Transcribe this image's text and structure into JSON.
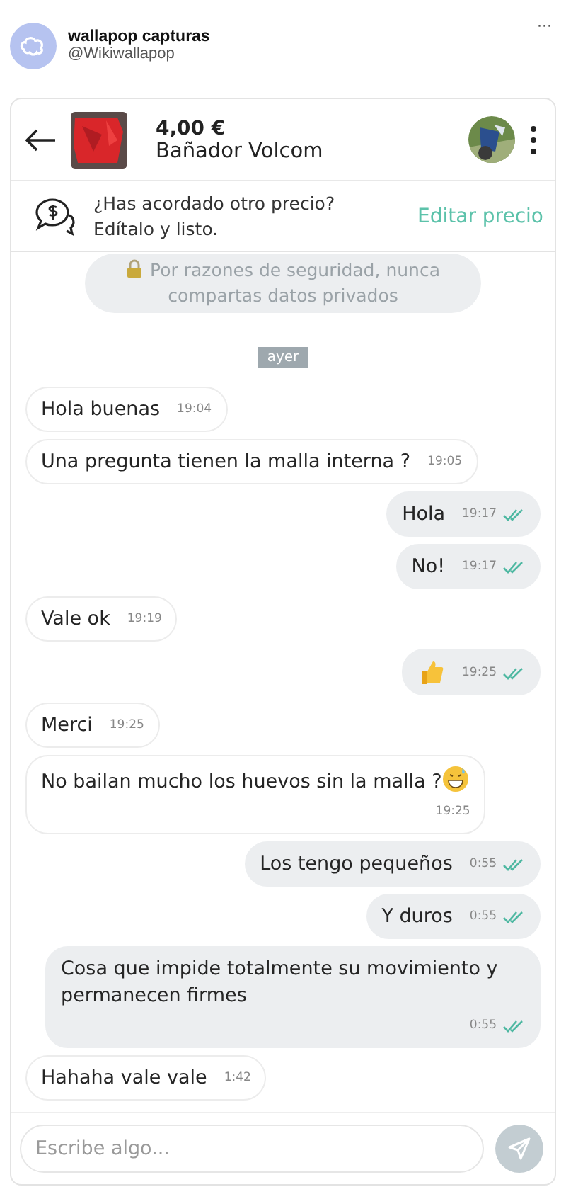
{
  "post": {
    "name": "wallapop capturas",
    "handle": "@Wikiwallapop",
    "more": "···"
  },
  "chat_header": {
    "price": "4,00 €",
    "title": "Bañador Volcom"
  },
  "price_banner": {
    "question": "¿Has acordado otro precio?",
    "hint": "Edítalo y listo.",
    "action": "Editar precio"
  },
  "security_notice": "Por razones de seguridad, nunca compartas datos privados",
  "day_label": "ayer",
  "messages": [
    {
      "kind": "short",
      "text": "Hola buenas",
      "time": "19:04",
      "sent": false
    },
    {
      "kind": "short",
      "text": "Una pregunta tienen la malla interna ?",
      "time": "19:05",
      "sent": false
    },
    {
      "kind": "short",
      "text": "Hola",
      "time": "19:17",
      "sent": true,
      "read": true
    },
    {
      "kind": "short",
      "text": "No!",
      "time": "19:17",
      "sent": true,
      "read": true
    },
    {
      "kind": "short",
      "text": "Vale ok",
      "time": "19:19",
      "sent": false
    },
    {
      "kind": "thumbs",
      "time": "19:25",
      "sent": true,
      "read": true
    },
    {
      "kind": "short",
      "text": "Merci",
      "time": "19:25",
      "sent": false
    },
    {
      "kind": "grinning",
      "text": "No bailan mucho los huevos sin la malla ?",
      "time": "19:25",
      "sent": false
    },
    {
      "kind": "short",
      "text": "Los tengo pequeños",
      "time": "0:55",
      "sent": true,
      "read": true
    },
    {
      "kind": "short",
      "text": "Y duros",
      "time": "0:55",
      "sent": true,
      "read": true
    },
    {
      "kind": "long",
      "text": "Cosa que impide totalmente su movimiento y permanecen firmes",
      "time": "0:55",
      "sent": true,
      "read": true
    },
    {
      "kind": "short",
      "text": "Hahaha vale vale",
      "time": "1:42",
      "sent": false
    }
  ],
  "composer": {
    "placeholder": "Escribe algo..."
  }
}
